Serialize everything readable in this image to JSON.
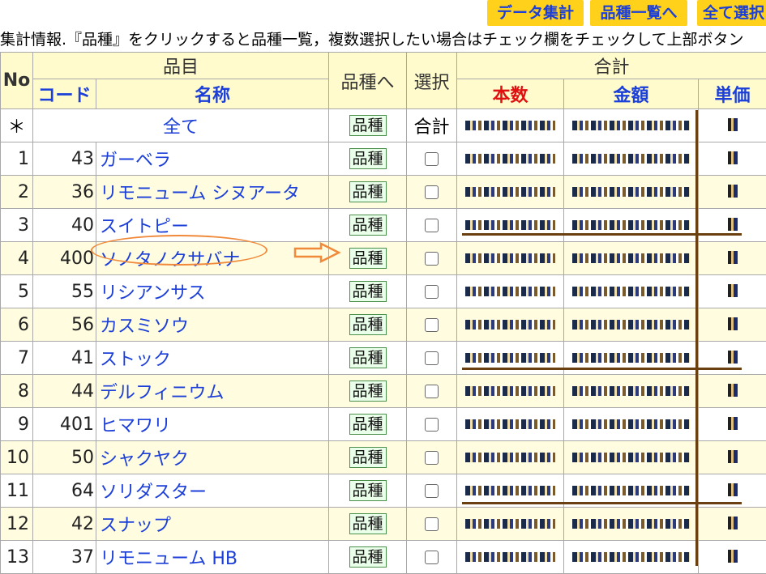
{
  "buttons": {
    "data_summary": "データ集計",
    "variety_list": "品種一覧へ",
    "select_all": "全て選択"
  },
  "info_text": "集計情報.『品種』をクリックすると品種一覧，複数選択したい場合はチェック欄をチェックして上部ボタン",
  "headers": {
    "no": "No",
    "item_group": "品目",
    "code": "コード",
    "name": "名称",
    "variety": "品種へ",
    "select": "選択",
    "total": "合計",
    "count": "本数",
    "amount": "金額",
    "unit_price": "単価"
  },
  "all_row": {
    "no": "＊",
    "name": "全て",
    "variety_btn": "品種",
    "select": "合計"
  },
  "rows": [
    {
      "no": "1",
      "code": "43",
      "name": "ガーベラ",
      "btn": "品種"
    },
    {
      "no": "2",
      "code": "36",
      "name": "リモニューム シヌアータ",
      "btn": "品種"
    },
    {
      "no": "3",
      "code": "40",
      "name": "スイトピー",
      "btn": "品種"
    },
    {
      "no": "4",
      "code": "400",
      "name": "ソノタノクサバナ",
      "btn": "品種"
    },
    {
      "no": "5",
      "code": "55",
      "name": "リシアンサス",
      "btn": "品種"
    },
    {
      "no": "6",
      "code": "56",
      "name": "カスミソウ",
      "btn": "品種"
    },
    {
      "no": "7",
      "code": "41",
      "name": "ストック",
      "btn": "品種"
    },
    {
      "no": "8",
      "code": "44",
      "name": "デルフィニウム",
      "btn": "品種"
    },
    {
      "no": "9",
      "code": "401",
      "name": "ヒマワリ",
      "btn": "品種"
    },
    {
      "no": "10",
      "code": "50",
      "name": "シャクヤク",
      "btn": "品種"
    },
    {
      "no": "11",
      "code": "64",
      "name": "ソリダスター",
      "btn": "品種"
    },
    {
      "no": "12",
      "code": "42",
      "name": "スナップ",
      "btn": "品種"
    },
    {
      "no": "13",
      "code": "37",
      "name": "リモニューム HB",
      "btn": "品種"
    }
  ],
  "colors": {
    "header_bg": "#fffbcc",
    "button_bg": "#ffd11a",
    "link": "#1b3fd8",
    "accent_red": "#e01010",
    "annotation": "#f08a3a"
  }
}
